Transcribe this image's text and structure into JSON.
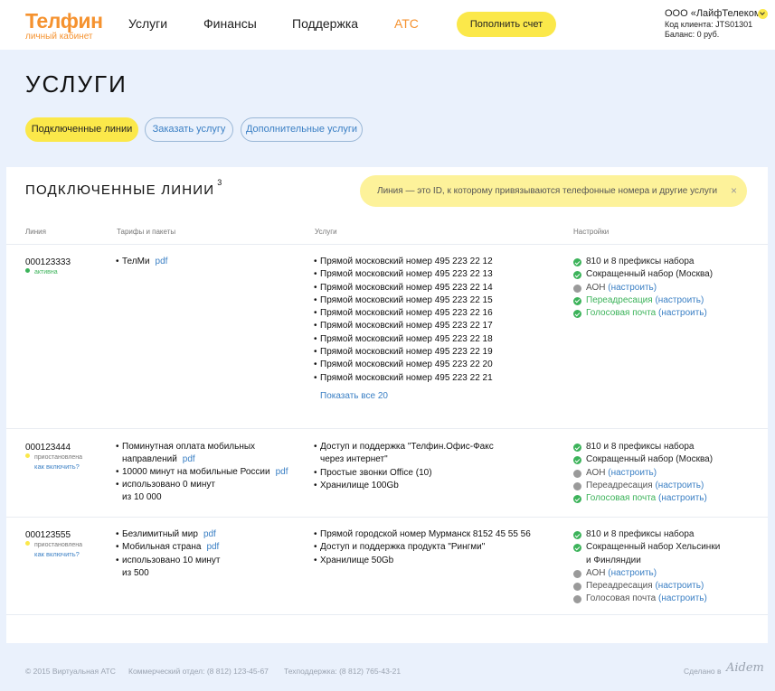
{
  "header": {
    "logo_main": "Телфин",
    "logo_sub": "личный кабинет",
    "nav": [
      "Услуги",
      "Финансы",
      "Поддержка",
      "АТС"
    ],
    "topup_label": "Пополнить счет",
    "account": {
      "name": "ООО «ЛайфТелеком»",
      "client_code": "Код клиента: JTS01301",
      "balance": "Баланс: 0 руб."
    }
  },
  "page_title": "УСЛУГИ",
  "tabs": [
    "Подключенные линии",
    "Заказать услугу",
    "Дополнительные услуги"
  ],
  "section": {
    "title": "ПОДКЛЮЧЕННЫЕ ЛИНИИ",
    "count": "3",
    "hint": "Линия — это ID, к которому привязываются телефонные номера и другие услуги",
    "hint_close": "×"
  },
  "columns": [
    "Линия",
    "Тарифы и пакеты",
    "Услуги",
    "Настройки"
  ],
  "rows": [
    {
      "line": "000123333",
      "status": "активна",
      "tariffs": [
        {
          "name": "ТелМи",
          "pdf": "pdf"
        }
      ],
      "services": [
        "Прямой московский номер 495 223 22 12",
        "Прямой московский номер 495 223 22 13",
        "Прямой московский номер 495 223 22 14",
        "Прямой московский номер 495 223 22 15",
        "Прямой московский номер 495 223 22 16",
        "Прямой московский номер 495 223 22 17",
        "Прямой московский номер 495 223 22 18",
        "Прямой московский номер 495 223 22 19",
        "Прямой московский номер 495 223 22 20",
        "Прямой московский номер 495 223 22 21"
      ],
      "show_all": "Показать все 20",
      "settings": [
        {
          "label": "810 и 8 префиксы набора",
          "state": "ok",
          "tone": "default"
        },
        {
          "label": "Сокращенный набор (Москва)",
          "state": "ok",
          "tone": "default"
        },
        {
          "label": "АОН",
          "state": "off",
          "tone": "grey",
          "configure": "(настроить)"
        },
        {
          "label": "Переадресация",
          "state": "ok",
          "tone": "green",
          "configure": "(настроить)"
        },
        {
          "label": "Голосовая почта",
          "state": "ok",
          "tone": "green",
          "configure": "(настроить)"
        }
      ]
    },
    {
      "line": "000123444",
      "status": "приостановлена",
      "howto": "как включить?",
      "tariffs": [
        {
          "name_1": "Поминутная оплата мобильных",
          "name_2": "направлений",
          "pdf": "pdf"
        },
        {
          "name": "10000 минут на мобильные России",
          "pdf": "pdf",
          "used_1": "использовано 0 минут",
          "used_2": "из 10 000"
        }
      ],
      "services": [
        "Доступ и поддержка \"Телфин.Офис-Факс",
        "через интернет\"",
        "Простые звонки Office (10)",
        "Хранилище 100Gb"
      ],
      "settings": [
        {
          "label": "810 и 8 префиксы набора",
          "state": "ok",
          "tone": "default"
        },
        {
          "label": "Сокращенный набор (Москва)",
          "state": "ok",
          "tone": "default"
        },
        {
          "label": "АОН",
          "state": "off",
          "tone": "grey",
          "configure": "(настроить)"
        },
        {
          "label": "Переадресация",
          "state": "off",
          "tone": "grey",
          "configure": "(настроить)"
        },
        {
          "label": "Голосовая почта",
          "state": "ok",
          "tone": "green",
          "configure": "(настроить)"
        }
      ]
    },
    {
      "line": "000123555",
      "status": "приостановлена",
      "howto": "как включить?",
      "tariffs": [
        {
          "name": "Безлимитный мир",
          "pdf": "pdf"
        },
        {
          "name": "Мобильная страна",
          "pdf": "pdf",
          "used_1": "использовано 10 минут",
          "used_2": "из 500"
        }
      ],
      "services": [
        "Прямой городской номер Мурманск 8152 45 55 56",
        "Доступ и поддержка продукта \"Рингми\"",
        "Хранилище 50Gb"
      ],
      "settings": [
        {
          "label": "810 и 8 префиксы набора",
          "state": "ok",
          "tone": "default"
        },
        {
          "label_1": "Сокращенный набор Хельсинки",
          "label_2": "и Финляндии",
          "state": "ok",
          "tone": "default"
        },
        {
          "label": "АОН",
          "state": "off",
          "tone": "grey",
          "configure": "(настроить)"
        },
        {
          "label": "Переадресация",
          "state": "off",
          "tone": "grey",
          "configure": "(настроить)"
        },
        {
          "label": "Голосовая почта",
          "state": "off",
          "tone": "grey",
          "configure": "(настроить)"
        }
      ]
    }
  ],
  "footer": {
    "copyright": "© 2015 Виртуальная АТС",
    "sales": "Коммерческий отдел: (8 812) 123-45-67",
    "support": "Техподдержка: (8 812) 765-43-21",
    "made_by": "Сделано в",
    "made_by_sig": "Aidem"
  },
  "colors": {
    "brand": "#f5922f",
    "accent": "#fbe84a",
    "link": "#3a7fc4",
    "active": "#3cb35a",
    "disabled": "#9a9a9a",
    "background": "#eaf1fc"
  }
}
